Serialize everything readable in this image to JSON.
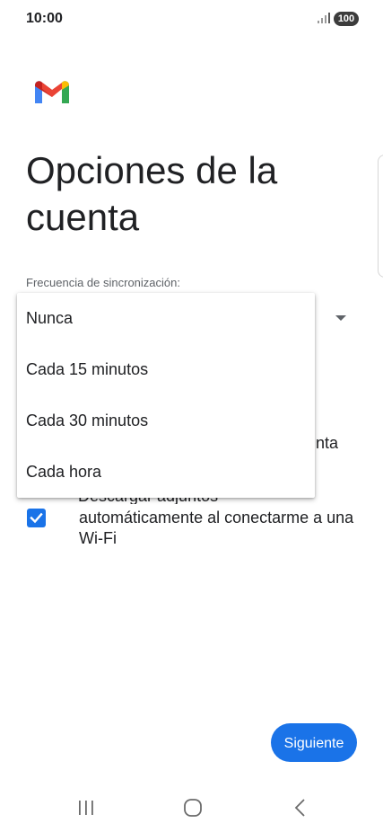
{
  "status_bar": {
    "time": "10:00",
    "battery": "100",
    "signal_icon": "signal-bars-icon"
  },
  "header": {
    "logo_icon": "gmail-logo-icon",
    "title": "Opciones de la cuenta"
  },
  "sync": {
    "label": "Frecuencia de sincronización:",
    "dropdown_icon": "caret-down-icon",
    "options": [
      "Nunca",
      "Cada 15 minutos",
      "Cada 30 minutos",
      "Cada hora"
    ]
  },
  "background_text": {
    "notify_fragment": "nta",
    "partial_line": "Descargar adjuntos"
  },
  "download_option": {
    "checked": true,
    "text": "automáticamente al conectarme a una Wi-Fi"
  },
  "footer": {
    "next_label": "Siguiente"
  },
  "nav": {
    "recent_icon": "recent-apps-icon",
    "home_icon": "home-icon",
    "back_icon": "back-icon"
  },
  "colors": {
    "accent": "#1a73e8",
    "text": "#202124",
    "secondary_text": "#5f6368"
  }
}
